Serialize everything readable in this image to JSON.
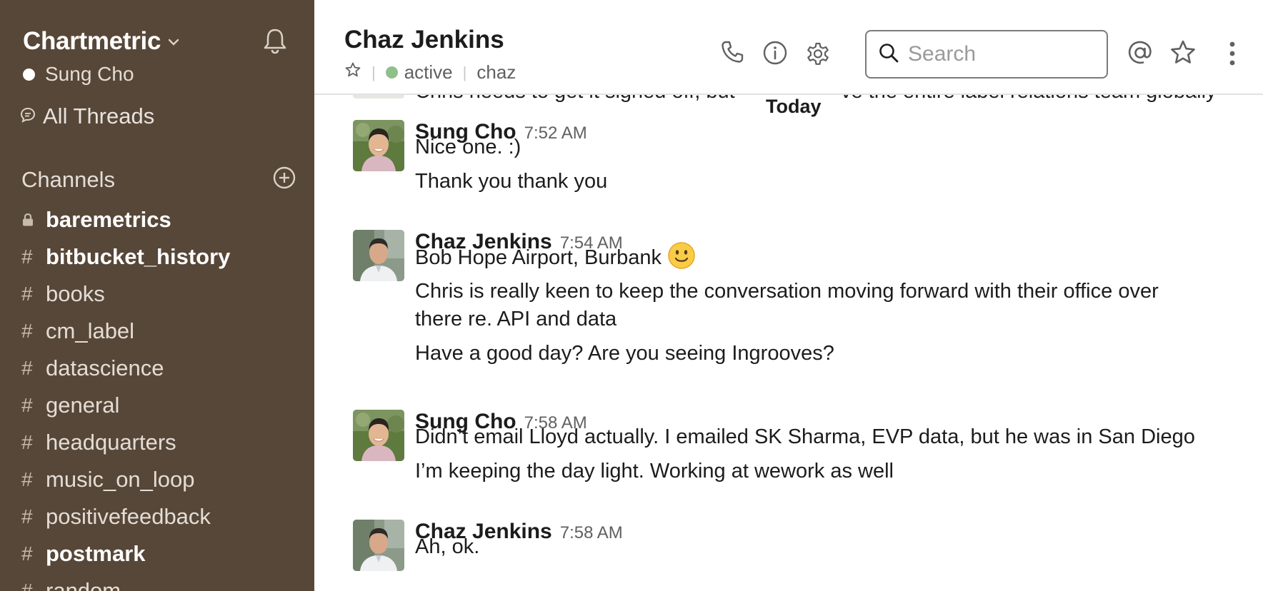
{
  "sidebar": {
    "team_name": "Chartmetric",
    "user_name": "Sung Cho",
    "all_threads": "All Threads",
    "channels_label": "Channels",
    "channels": [
      {
        "prefix": "lock",
        "name": "baremetrics",
        "unread": true
      },
      {
        "prefix": "#",
        "name": "bitbucket_history",
        "unread": true
      },
      {
        "prefix": "#",
        "name": "books",
        "unread": false
      },
      {
        "prefix": "#",
        "name": "cm_label",
        "unread": false
      },
      {
        "prefix": "#",
        "name": "datascience",
        "unread": false
      },
      {
        "prefix": "#",
        "name": "general",
        "unread": false
      },
      {
        "prefix": "#",
        "name": "headquarters",
        "unread": false
      },
      {
        "prefix": "#",
        "name": "music_on_loop",
        "unread": false
      },
      {
        "prefix": "#",
        "name": "positivefeedback",
        "unread": false
      },
      {
        "prefix": "#",
        "name": "postmark",
        "unread": true
      },
      {
        "prefix": "#",
        "name": "random",
        "unread": false
      }
    ],
    "colors": {
      "background": "#574738",
      "presence": "#ffffff"
    }
  },
  "header": {
    "title": "Chaz Jenkins",
    "status": "active",
    "handle": "chaz",
    "search_placeholder": "Search",
    "icons": [
      "phone-icon",
      "info-icon",
      "gear-icon",
      "search-icon",
      "at-mention-icon",
      "star-icon",
      "more-vertical-icon"
    ],
    "colors": {
      "active": "#8fc08a"
    }
  },
  "messages": {
    "cut_off_text_left": "Chris needs to get it signed off, but",
    "cut_off_text_right": "ve the entire label relations team globally",
    "day_divider": "Today",
    "groups": [
      {
        "author": "Sung Cho",
        "time": "7:52 AM",
        "lines": [
          "Nice one. :)",
          "Thank you thank you"
        ]
      },
      {
        "author": "Chaz Jenkins",
        "time": "7:54 AM",
        "lines": [
          "Bob Hope Airport, Burbank",
          "Chris is really keen to keep the conversation moving forward with their office over",
          "there re. API and data",
          "Have a good day? Are you seeing Ingrooves?"
        ]
      },
      {
        "author": "Sung Cho",
        "time": "7:58 AM",
        "lines": [
          "Didn’t email Lloyd actually. I emailed SK Sharma, EVP data, but he was in San Diego",
          "I’m keeping the day light. Working at wework as well"
        ]
      },
      {
        "author": "Chaz Jenkins",
        "time": "7:58 AM",
        "lines": [
          "Ah, ok."
        ]
      }
    ]
  }
}
